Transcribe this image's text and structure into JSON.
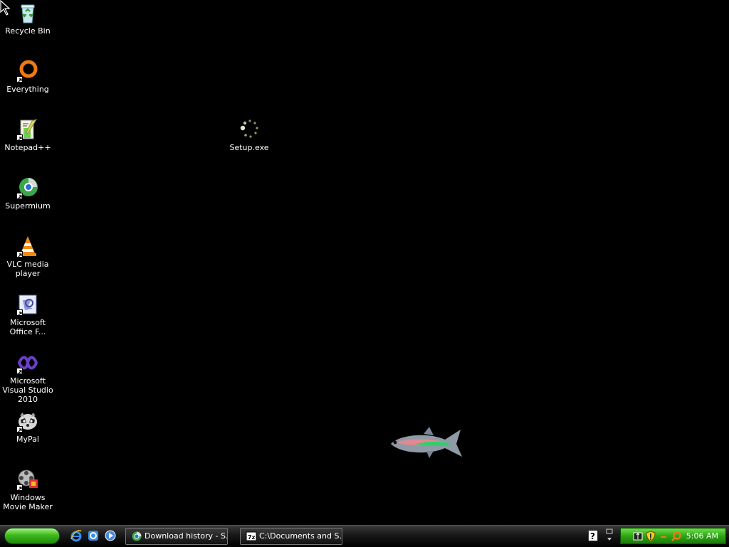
{
  "desktop": {
    "icons": [
      {
        "label": "Recycle Bin",
        "icon": "recycle-bin-icon"
      },
      {
        "label": "Everything",
        "icon": "everything-search-icon"
      },
      {
        "label": "Notepad++",
        "icon": "notepad-plus-plus-icon"
      },
      {
        "label": "Supermium",
        "icon": "supermium-browser-icon"
      },
      {
        "label": "VLC media player",
        "icon": "vlc-cone-icon"
      },
      {
        "label": "Microsoft Office F...",
        "icon": "office-document-icon"
      },
      {
        "label": "Microsoft Visual Studio 2010",
        "icon": "visual-studio-icon"
      },
      {
        "label": "MyPal",
        "icon": "mypal-raccoon-icon"
      },
      {
        "label": "Windows Movie Maker",
        "icon": "movie-maker-icon"
      },
      {
        "label": "Setup.exe",
        "icon": "loading-spinner-icon"
      }
    ]
  },
  "taskbar": {
    "start_label": "",
    "quick_launch": [
      "internet-explorer-icon",
      "ie-alt-icon",
      "media-player-icon"
    ],
    "tasks": [
      {
        "label": "Download history - S...",
        "icon": "browser-icon"
      },
      {
        "label": "C:\\Documents and S...",
        "icon": "7zip-icon"
      }
    ],
    "tray": {
      "clock": "5:06 AM",
      "icons": [
        "network-icon",
        "security-shield-icon",
        "dash-icon",
        "search-icon"
      ]
    }
  },
  "colors": {
    "desktop_bg": "#000000",
    "start_green": "#3cb81e",
    "tray_green": "#2fa416"
  }
}
